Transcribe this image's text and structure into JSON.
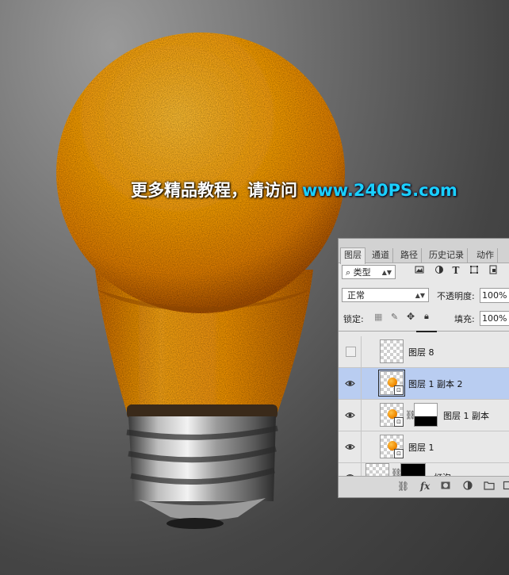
{
  "watermark": {
    "text_cn": "更多精品教程，请访问",
    "url": "www.240PS.com"
  },
  "colors": {
    "orange_light": "#ffb21f",
    "orange_mid": "#f59a0c",
    "orange_dark": "#b95d00",
    "metal_light": "#dcdcdc",
    "metal_dark": "#2e2e2e",
    "panel_bg": "#e8e8e8",
    "selection": "#b9cdf1",
    "watermark_url": "#1ad0ff"
  },
  "panel": {
    "tabs": [
      "图层",
      "通道",
      "路径",
      "历史记录",
      "动作"
    ],
    "active_tab": "图层",
    "filter": {
      "label": "类型"
    },
    "filter_icons": [
      "image-filter-icon",
      "adjustment-filter-icon",
      "type-filter-icon",
      "shape-filter-icon",
      "smart-object-filter-icon"
    ],
    "blend_mode": "正常",
    "opacity_label": "不透明度:",
    "opacity_value": "100%",
    "lock_label": "锁定:",
    "fill_label": "填充:",
    "fill_value": "100%",
    "layers": [
      {
        "name": "图层 8",
        "visible": false,
        "selected": false
      },
      {
        "name": "图层 1 副本 2",
        "visible": true,
        "selected": true
      },
      {
        "name": "图层 1 副本",
        "visible": true,
        "selected": false
      },
      {
        "name": "图层 1",
        "visible": true,
        "selected": false
      },
      {
        "name": "灯泡",
        "visible": true,
        "selected": false
      }
    ],
    "footer_icons": [
      "link-icon",
      "fx-icon",
      "mask-icon",
      "adjustment-icon",
      "folder-icon",
      "new-layer-icon"
    ],
    "fx_label": "fx"
  }
}
